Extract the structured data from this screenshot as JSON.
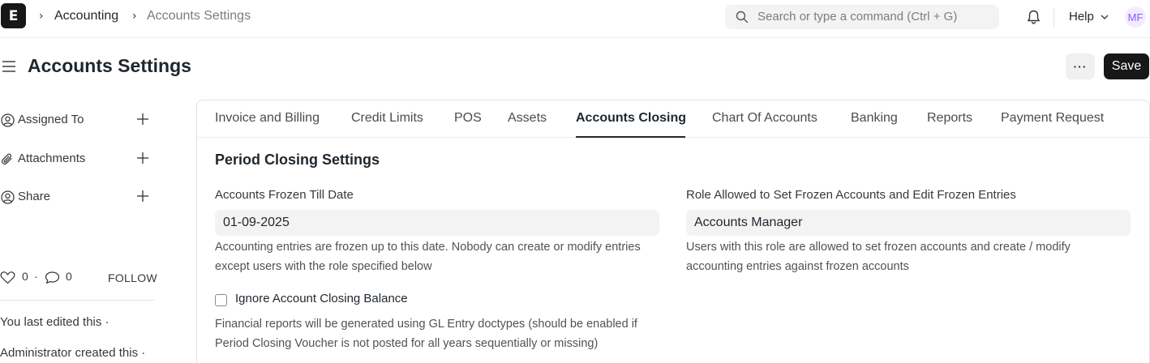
{
  "navbar": {
    "logo_letter": "E",
    "breadcrumbs": [
      "Accounting",
      "Accounts Settings"
    ],
    "search_placeholder": "Search or type a command (Ctrl + G)",
    "help_label": "Help",
    "avatar_initials": "MF"
  },
  "page": {
    "title": "Accounts Settings",
    "more_label": "···",
    "save_label": "Save"
  },
  "sidebar": {
    "items": [
      {
        "label": "Assigned To",
        "icon": "user-add-icon"
      },
      {
        "label": "Attachments",
        "icon": "paperclip-icon"
      },
      {
        "label": "Share",
        "icon": "user-share-icon"
      }
    ],
    "likes": "0",
    "comments": "0",
    "dot": "·",
    "follow_label": "FOLLOW",
    "activity": [
      "You last edited this ·",
      "Administrator created this ·"
    ]
  },
  "tabs": [
    {
      "label": "Invoice and Billing",
      "active": false
    },
    {
      "label": "Credit Limits",
      "active": false
    },
    {
      "label": "POS",
      "active": false
    },
    {
      "label": "Assets",
      "active": false
    },
    {
      "label": "Accounts Closing",
      "active": true
    },
    {
      "label": "Chart Of Accounts",
      "active": false
    },
    {
      "label": "Banking",
      "active": false
    },
    {
      "label": "Reports",
      "active": false
    },
    {
      "label": "Payment Request",
      "active": false
    }
  ],
  "section": {
    "title": "Period Closing Settings",
    "frozen_date": {
      "label": "Accounts Frozen Till Date",
      "value": "01-09-2025",
      "description": "Accounting entries are frozen up to this date. Nobody can create or modify entries except users with the role specified below"
    },
    "frozen_role": {
      "label": "Role Allowed to Set Frozen Accounts and Edit Frozen Entries",
      "value": "Accounts Manager",
      "description": "Users with this role are allowed to set frozen accounts and create / modify accounting entries against frozen accounts"
    },
    "ignore_closing": {
      "label": "Ignore Account Closing Balance",
      "checked": false,
      "description": "Financial reports will be generated using GL Entry doctypes (should be enabled if Period Closing Voucher is not posted for all years sequentially or missing)"
    }
  }
}
